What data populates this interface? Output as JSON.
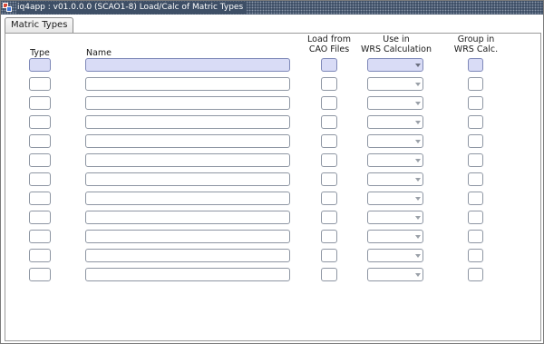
{
  "window": {
    "title": "iq4app : v01.0.0.0 (SCAO1-8) Load/Calc of Matric Types",
    "icon": "app-icon"
  },
  "tabs": [
    {
      "label": "Matric Types",
      "selected": true
    }
  ],
  "columns": {
    "type": "Type",
    "name": "Name",
    "load_line1": "Load from",
    "load_line2": "CAO Files",
    "wrs_line1": "Use in",
    "wrs_line2": "WRS Calculation",
    "group_line1": "Group in",
    "group_line2": "WRS Calc."
  },
  "rows": [
    {
      "type": "",
      "name": "",
      "load": false,
      "wrs": "",
      "group": false,
      "active": true
    },
    {
      "type": "",
      "name": "",
      "load": false,
      "wrs": "",
      "group": false
    },
    {
      "type": "",
      "name": "",
      "load": false,
      "wrs": "",
      "group": false
    },
    {
      "type": "",
      "name": "",
      "load": false,
      "wrs": "",
      "group": false
    },
    {
      "type": "",
      "name": "",
      "load": false,
      "wrs": "",
      "group": false
    },
    {
      "type": "",
      "name": "",
      "load": false,
      "wrs": "",
      "group": false
    },
    {
      "type": "",
      "name": "",
      "load": false,
      "wrs": "",
      "group": false
    },
    {
      "type": "",
      "name": "",
      "load": false,
      "wrs": "",
      "group": false
    },
    {
      "type": "",
      "name": "",
      "load": false,
      "wrs": "",
      "group": false
    },
    {
      "type": "",
      "name": "",
      "load": false,
      "wrs": "",
      "group": false
    },
    {
      "type": "",
      "name": "",
      "load": false,
      "wrs": "",
      "group": false
    },
    {
      "type": "",
      "name": "",
      "load": false,
      "wrs": "",
      "group": false
    }
  ],
  "colors": {
    "titlebar": "#3e4f66",
    "active_row_fill": "#d9dcf6",
    "field_border": "#8e96a3"
  }
}
